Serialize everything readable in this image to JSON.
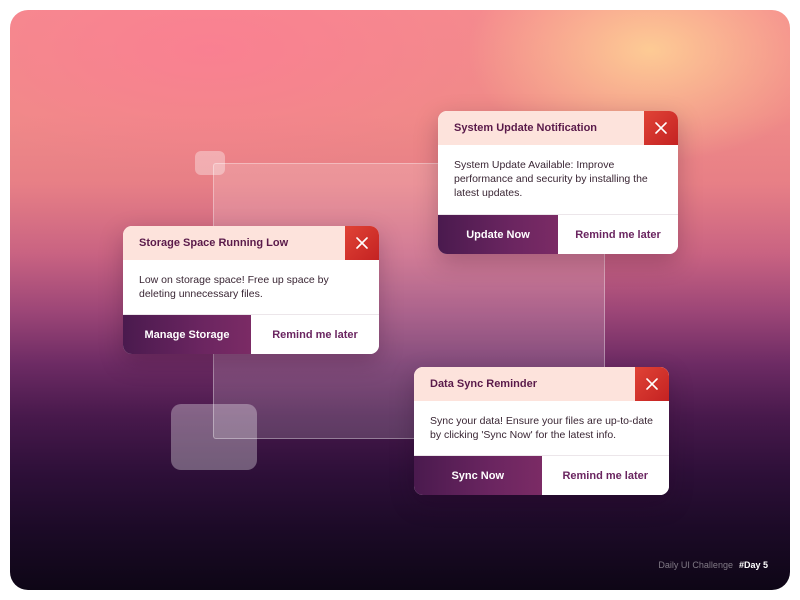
{
  "footer": {
    "challenge": "Daily UI Challenge",
    "day": "#Day 5"
  },
  "notifications": [
    {
      "title": "System Update Notification",
      "body": "System Update Available: Improve performance and security by installing the latest updates.",
      "primary": "Update Now",
      "secondary": "Remind me later"
    },
    {
      "title": "Storage Space Running Low",
      "body": "Low on storage space! Free up space by deleting unnecessary files.",
      "primary": "Manage Storage",
      "secondary": "Remind me later"
    },
    {
      "title": "Data Sync Reminder",
      "body": "Sync your data! Ensure your files are up-to-date by clicking 'Sync Now' for the latest info.",
      "primary": "Sync Now",
      "secondary": "Remind me later"
    }
  ],
  "colors": {
    "header_bg": "#fde3dc",
    "close_bg": "#d43a2e",
    "primary_btn": "#5a1f55",
    "accent_text": "#6a2560"
  }
}
